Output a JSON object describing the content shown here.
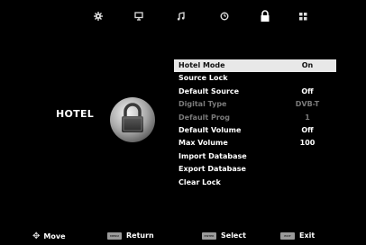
{
  "topbar": {
    "icons": [
      {
        "name": "picture-gear-icon"
      },
      {
        "name": "tv-channel-icon"
      },
      {
        "name": "music-note-icon"
      },
      {
        "name": "clock-icon"
      },
      {
        "name": "lock-icon",
        "active": true
      },
      {
        "name": "app-grid-icon"
      }
    ]
  },
  "category": "HOTEL",
  "menu": {
    "items": [
      {
        "label": "Hotel Mode",
        "value": "On",
        "state": "selected"
      },
      {
        "label": "Source Lock",
        "value": "",
        "state": "normal"
      },
      {
        "label": "Default Source",
        "value": "Off",
        "state": "normal"
      },
      {
        "label": "Digital Type",
        "value": "DVB-T",
        "state": "disabled"
      },
      {
        "label": "Default Prog",
        "value": "1",
        "state": "disabled"
      },
      {
        "label": "Default Volume",
        "value": "Off",
        "state": "normal"
      },
      {
        "label": "Max Volume",
        "value": "100",
        "state": "normal"
      },
      {
        "label": "Import Database",
        "value": "",
        "state": "normal"
      },
      {
        "label": "Export Database",
        "value": "",
        "state": "normal"
      },
      {
        "label": "Clear Lock",
        "value": "",
        "state": "normal"
      }
    ]
  },
  "bottombar": {
    "move": "Move",
    "menu_key": "MENU",
    "return": "Return",
    "enter_key": "ENTER",
    "select": "Select",
    "exit_key": "EXIT",
    "exit": "Exit"
  }
}
